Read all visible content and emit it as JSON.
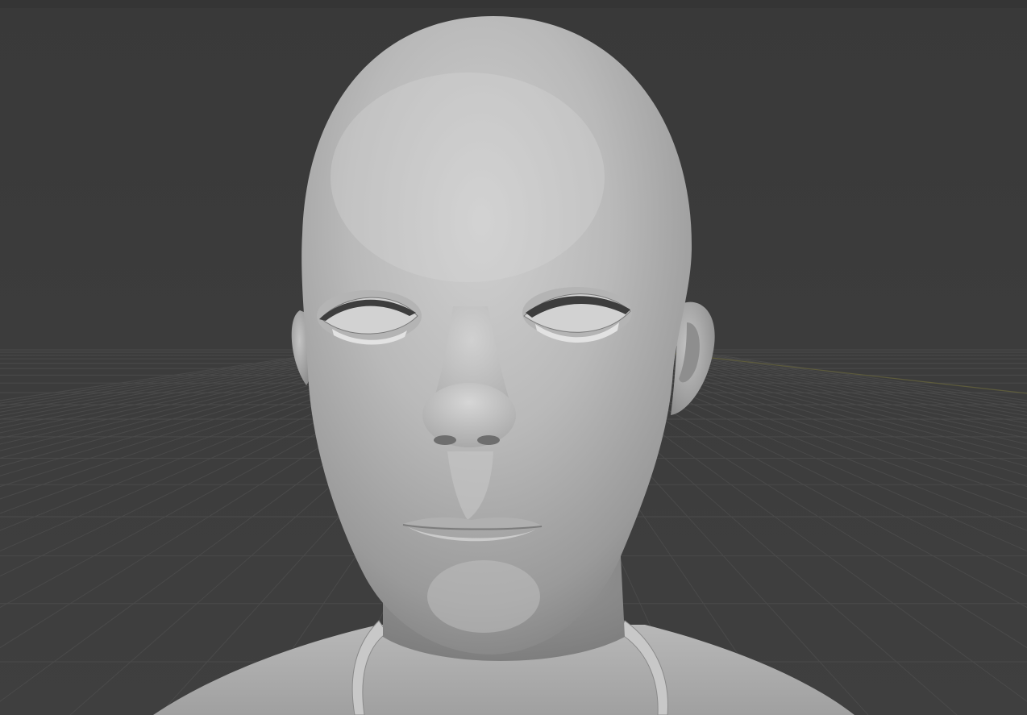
{
  "viewport": {
    "mode": "3d-viewport",
    "shading": "solid",
    "grid_floor": true,
    "axis_line": "x-axis",
    "visible_text": []
  },
  "scene": {
    "object": "human-head-sculpt",
    "eyes": "closed",
    "eyelashes": true,
    "clothing": "shirt-collar"
  },
  "colors": {
    "background": "#3d3d3d",
    "grid": "#4a4a4a",
    "x_axis": "#5a5a3a",
    "skin_light": "#c9c9c9",
    "skin_mid": "#a8a8a8",
    "skin_dark": "#6f6f6f",
    "lash": "#3a3a3a"
  }
}
